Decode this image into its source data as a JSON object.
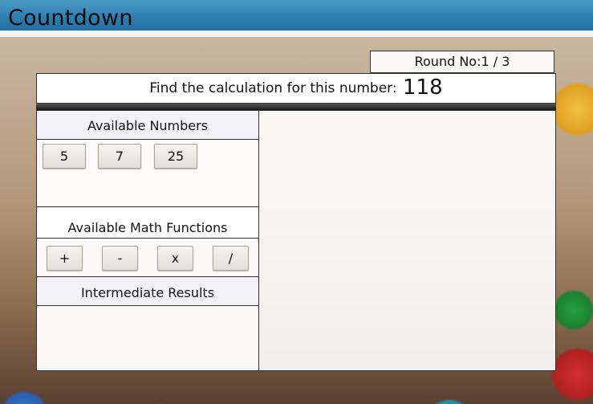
{
  "app": {
    "title": "Countdown"
  },
  "round": {
    "label": "Round No:1 / 3"
  },
  "target": {
    "prompt": "Find the calculation for this number:",
    "value": "118"
  },
  "numbers": {
    "heading": "Available Numbers",
    "items": [
      "5",
      "7",
      "25"
    ]
  },
  "functions": {
    "heading": "Available Math Functions",
    "items": [
      "+",
      "-",
      "x",
      "/"
    ]
  },
  "intermediate": {
    "heading": "Intermediate Results"
  }
}
